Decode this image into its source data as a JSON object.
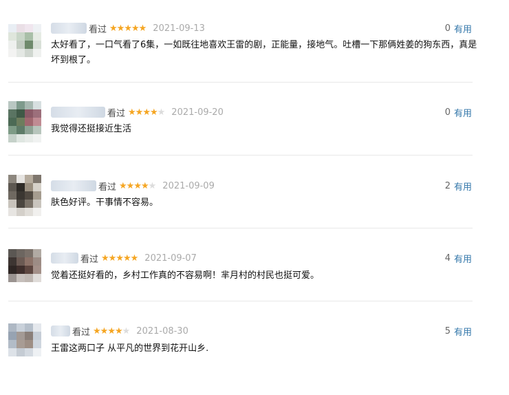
{
  "comments": [
    {
      "watched_label": "看过",
      "rating": 5,
      "date": "2021-09-13",
      "useful_count": "0",
      "useful_label": "有用",
      "text": "太好看了，一口气看了6集，一如既往地喜欢王雷的剧，正能量，接地气。吐槽一下那俩姓姜的狗东西，真是坏到根了。"
    },
    {
      "watched_label": "看过",
      "rating": 4,
      "date": "2021-09-20",
      "useful_count": "0",
      "useful_label": "有用",
      "text": "我觉得还挺接近生活"
    },
    {
      "watched_label": "看过",
      "rating": 4,
      "date": "2021-09-09",
      "useful_count": "2",
      "useful_label": "有用",
      "text": "肤色好评。干事情不容易。"
    },
    {
      "watched_label": "看过",
      "rating": 5,
      "date": "2021-09-07",
      "useful_count": "4",
      "useful_label": "有用",
      "text": "觉着还挺好看的，乡村工作真的不容易啊！芈月村的村民也挺可爱。"
    },
    {
      "watched_label": "看过",
      "rating": 4,
      "date": "2021-08-30",
      "useful_count": "5",
      "useful_label": "有用",
      "text": "王雷这两口子 从平凡的世界到花开山乡."
    }
  ],
  "colors": {
    "star_on": "#f5a623",
    "star_off": "#dcdcdc",
    "link": "#3377aa",
    "date": "#aaaaaa"
  }
}
